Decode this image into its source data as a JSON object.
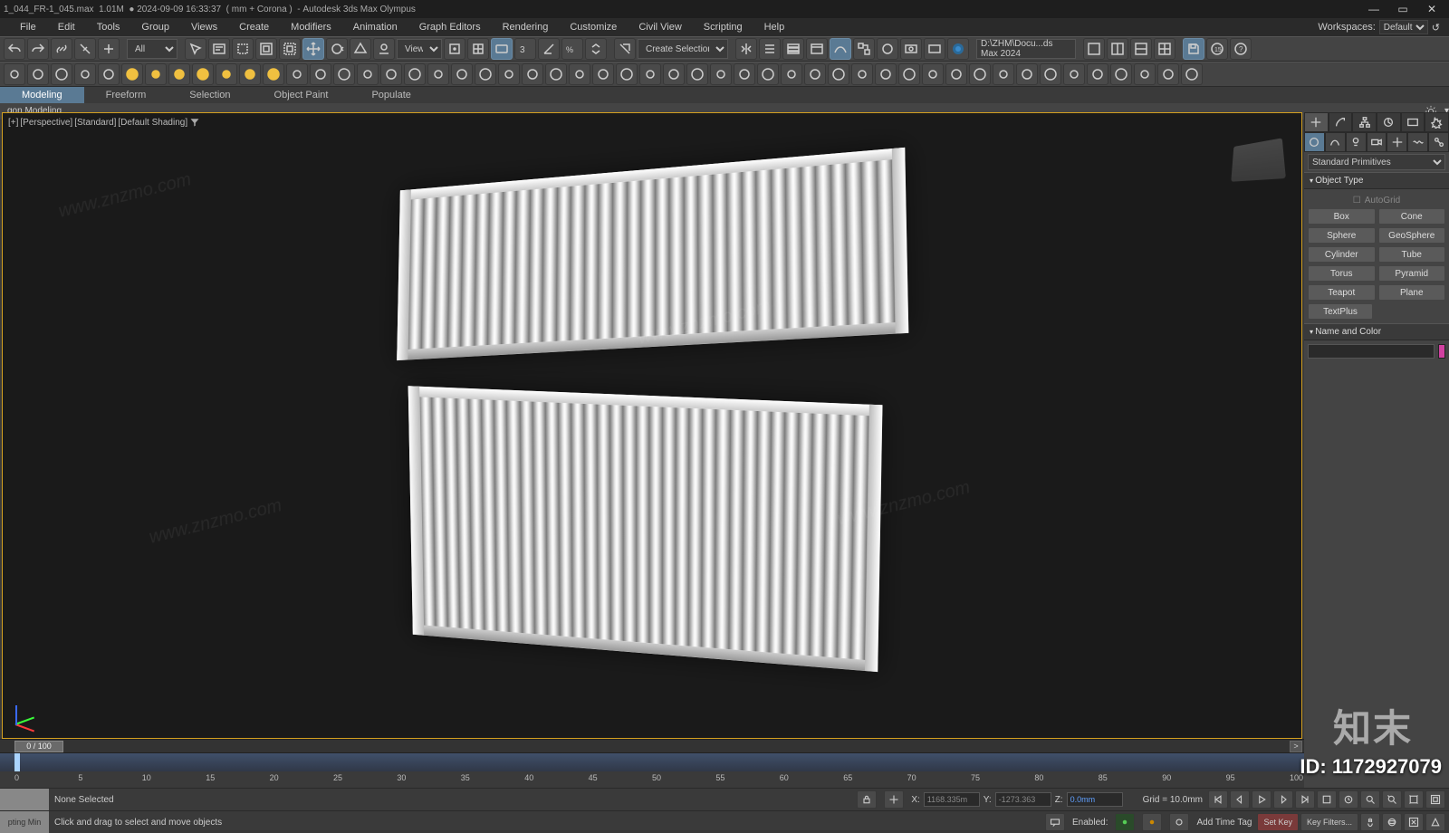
{
  "title_bar": {
    "filename": "1_044_FR-1_045.max",
    "filesize": "1.01M",
    "timestamp": "2024-09-09 16:33:37",
    "unit_renderer": "( mm + Corona )",
    "app": "Autodesk 3ds Max Olympus"
  },
  "menu": [
    "File",
    "Edit",
    "Tools",
    "Group",
    "Views",
    "Create",
    "Modifiers",
    "Animation",
    "Graph Editors",
    "Rendering",
    "Customize",
    "Civil View",
    "Scripting",
    "Help"
  ],
  "workspace": {
    "label": "Workspaces:",
    "value": "Default"
  },
  "toolbar1": {
    "all_filter": "All",
    "view_label": "View",
    "create_sel_set": "Create Selection Set",
    "path": "D:\\ZHM\\Docu...ds Max 2024"
  },
  "ribbon_tabs": [
    "Modeling",
    "Freeform",
    "Selection",
    "Object Paint",
    "Populate"
  ],
  "ribbon_sub": "gon Modeling",
  "viewport": {
    "labels": [
      "[+]",
      "[Perspective]",
      "[Standard]",
      "[Default Shading]"
    ]
  },
  "cmd_panel": {
    "dropdown": "Standard Primitives",
    "rollout1": "Object Type",
    "autogrid": "AutoGrid",
    "primitives": [
      "Box",
      "Cone",
      "Sphere",
      "GeoSphere",
      "Cylinder",
      "Tube",
      "Torus",
      "Pyramid",
      "Teapot",
      "Plane",
      "TextPlus"
    ],
    "rollout2": "Name and Color",
    "name_value": ""
  },
  "timeline": {
    "slider": "0 / 100",
    "end_btn": ">",
    "ticks": [
      0,
      5,
      10,
      15,
      20,
      25,
      30,
      35,
      40,
      45,
      50,
      55,
      60,
      65,
      70,
      75,
      80,
      85,
      90,
      95,
      100
    ]
  },
  "status": {
    "row1_left": "",
    "row1_mid": "None Selected",
    "enabled_label": "Enabled:",
    "x_label": "X:",
    "x_val": "1168.335m",
    "y_label": "Y:",
    "y_val": "-1273.363",
    "z_label": "Z:",
    "z_val": "0.0mm",
    "grid": "Grid = 10.0mm",
    "add_time_tag": "Add Time Tag",
    "set_key": "Set Key",
    "key_filters": "Key Filters...",
    "row2_left": "pting Min",
    "prompt": "Click and drag to select and move objects"
  },
  "overlay": {
    "id_label": "ID: 1172927079",
    "brand": "知末",
    "wm": "www.znzmo.com"
  }
}
